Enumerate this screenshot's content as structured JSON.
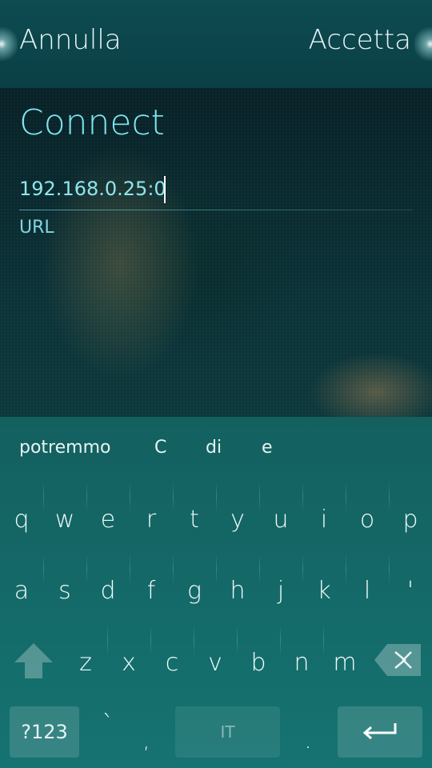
{
  "header": {
    "cancel_label": "Annulla",
    "accept_label": "Accetta"
  },
  "form": {
    "title": "Connect",
    "url_value": "192.168.0.25:0",
    "url_label": "URL"
  },
  "keyboard": {
    "suggestions": [
      "potremmo",
      "C",
      "di",
      "e"
    ],
    "row1": [
      "q",
      "w",
      "e",
      "r",
      "t",
      "y",
      "u",
      "i",
      "o",
      "p"
    ],
    "row2": [
      "a",
      "s",
      "d",
      "f",
      "g",
      "h",
      "j",
      "k",
      "l",
      "'"
    ],
    "row3": [
      "z",
      "x",
      "c",
      "v",
      "b",
      "n",
      "m"
    ],
    "symbols_label": "?123",
    "backtick": "`",
    "comma": ",",
    "space_label": "IT",
    "period": ".",
    "icons": {
      "shift": "shift-arrow-icon",
      "backspace": "backspace-icon",
      "enter": "enter-arrow-icon"
    }
  },
  "colors": {
    "accent": "#7fe6ef",
    "keyboard_bg": "#157371",
    "header_bg": "#0d4c52"
  }
}
